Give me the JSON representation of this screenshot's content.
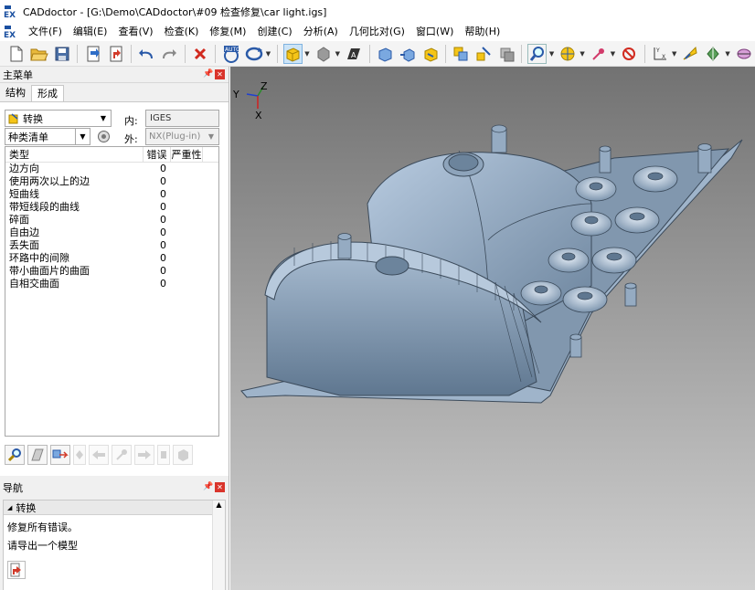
{
  "window": {
    "app_name": "CADdoctor",
    "title": "CADdoctor - [G:\\Demo\\CADdoctor\\#09 检查修复\\car light.igs]"
  },
  "menu": {
    "items": [
      "文件(F)",
      "编辑(E)",
      "查看(V)",
      "检查(K)",
      "修复(M)",
      "创建(C)",
      "分析(A)",
      "几何比对(G)",
      "窗口(W)",
      "帮助(H)"
    ]
  },
  "toolbar": {
    "icons": [
      "new-icon",
      "open-icon",
      "save-icon",
      "import-icon",
      "export-icon",
      "undo-icon",
      "redo-icon",
      "delete-icon",
      "auto-icon",
      "rotate-icon",
      "shaded-cube-icon",
      "gray-sphere-icon",
      "text-tool-icon",
      "cube-blue-icon",
      "cube-move-icon",
      "cube-yellow-icon",
      "swap-icon",
      "transform-icon",
      "layer-icon",
      "zoom-icon",
      "view-icon",
      "point-icon",
      "no-entry-icon",
      "axis-icon",
      "measure-icon",
      "light-icon",
      "section-icon"
    ]
  },
  "main_panel": {
    "title": "主菜单",
    "pin_icon": "pin-icon",
    "close_icon": "close-icon",
    "tabs": [
      {
        "label": "结构",
        "active": false
      },
      {
        "label": "形成",
        "active": true
      }
    ],
    "mode_select": {
      "value": "转换"
    },
    "inner_label": "内:",
    "inner_value": "IGES",
    "list_select": {
      "value": "种类清单"
    },
    "outer_label": "外:",
    "outer_value": "NX(Plug-in)",
    "columns": [
      "类型",
      "错误",
      "严重性"
    ],
    "rows": [
      {
        "type": "边方向",
        "errors": "0"
      },
      {
        "type": "使用两次以上的边",
        "errors": "0"
      },
      {
        "type": "短曲线",
        "errors": "0"
      },
      {
        "type": "带短线段的曲线",
        "errors": "0"
      },
      {
        "type": "碎面",
        "errors": "0"
      },
      {
        "type": "自由边",
        "errors": "0"
      },
      {
        "type": "丢失面",
        "errors": "0"
      },
      {
        "type": "环路中的间隙",
        "errors": "0"
      },
      {
        "type": "带小曲面片的曲面",
        "errors": "0"
      },
      {
        "type": "自相交曲面",
        "errors": "0"
      }
    ]
  },
  "nav_panel": {
    "title": "导航",
    "section": "转换",
    "line1": "修复所有错误。",
    "line2": "请导出一个模型"
  },
  "viewport": {
    "axis_labels": {
      "y": "Y",
      "z": "Z",
      "x": "X"
    },
    "colors": {
      "model": "#8da6bf",
      "model_dark": "#5f7790",
      "edge": "#3b4a5a"
    }
  }
}
